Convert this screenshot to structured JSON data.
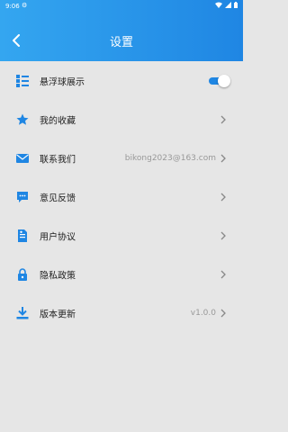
{
  "status_bar": {
    "time": "9:06"
  },
  "header": {
    "title": "设置",
    "back_icon": "back-chevron-icon"
  },
  "colors": {
    "accent": "#1f86e3",
    "header_start": "#34a6f0",
    "background": "#e6e6e6"
  },
  "settings": {
    "floating_ball": {
      "label": "悬浮球展示",
      "enabled": true,
      "icon": "list-icon"
    },
    "favorites": {
      "label": "我的收藏",
      "icon": "star-icon"
    },
    "contact": {
      "label": "联系我们",
      "value": "bikong2023@163.com",
      "icon": "mail-icon"
    },
    "feedback": {
      "label": "意见反馈",
      "icon": "chat-bubble-icon"
    },
    "user_agreement": {
      "label": "用户协议",
      "icon": "document-icon"
    },
    "privacy": {
      "label": "隐私政策",
      "icon": "lock-icon"
    },
    "version": {
      "label": "版本更新",
      "value": "v1.0.0",
      "icon": "download-icon"
    }
  }
}
